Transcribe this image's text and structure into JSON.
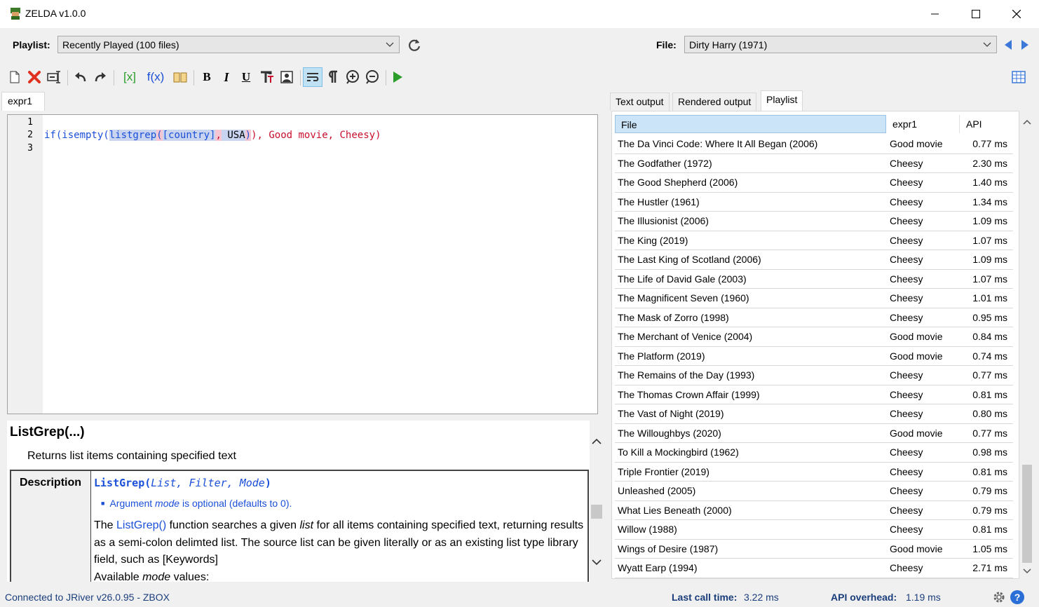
{
  "window": {
    "title": "ZELDA v1.0.0",
    "minimize": "—",
    "maximize": "☐",
    "close": "✕"
  },
  "playlist": {
    "label": "Playlist:",
    "value": "Recently Played (100 files)"
  },
  "file": {
    "label": "File:",
    "value": "Dirty Harry (1971)"
  },
  "toolbar": {
    "field_token": "[x]",
    "func_token": "f(x)",
    "bold": "B",
    "italic": "I",
    "underline": "U"
  },
  "editor": {
    "tab": "expr1",
    "line_numbers": [
      "1",
      "2",
      "3"
    ],
    "code": {
      "p1": "if(isempty(",
      "p2": "listg",
      "p3": "rep",
      "p4": "(",
      "p5": "[country]",
      "p6": ",",
      "p7": " USA",
      "p8": ")",
      "p9": "), Good movie, Cheesy)"
    }
  },
  "help": {
    "title": "ListGrep(...)",
    "subtitle": "Returns list items containing specified text",
    "desc_label": "Description",
    "sig_name": "ListGrep(",
    "sig_args": "List, Filter, Mode",
    "sig_close": ")",
    "arg_note_pre": "Argument ",
    "arg_note_em": "mode",
    "arg_note_post": " is optional (defaults to 0).",
    "body_1": "The ",
    "body_link": "ListGrep()",
    "body_2": " function searches a given ",
    "body_em": "list",
    "body_3": " for all items containing specified text, returning results as a semi-colon delimted list. The source list can be given literally or as an existing list type library field, such as [Keywords]",
    "body_4a": "Available ",
    "body_4em": "mode",
    "body_4b": " values:"
  },
  "right_tabs": [
    "Text output",
    "Rendered output",
    "Playlist"
  ],
  "table": {
    "columns": [
      "File",
      "expr1",
      "API"
    ],
    "rows": [
      [
        "The Da Vinci Code: Where It All Began (2006)",
        "Good movie",
        "0.77 ms"
      ],
      [
        "The Godfather (1972)",
        "Cheesy",
        "2.30 ms"
      ],
      [
        "The Good Shepherd (2006)",
        "Cheesy",
        "1.40 ms"
      ],
      [
        "The Hustler (1961)",
        "Cheesy",
        "1.34 ms"
      ],
      [
        "The Illusionist (2006)",
        "Cheesy",
        "1.09 ms"
      ],
      [
        "The King (2019)",
        "Cheesy",
        "1.07 ms"
      ],
      [
        "The Last King of Scotland (2006)",
        "Cheesy",
        "1.09 ms"
      ],
      [
        "The Life of David Gale (2003)",
        "Cheesy",
        "1.07 ms"
      ],
      [
        "The Magnificent Seven (1960)",
        "Cheesy",
        "1.01 ms"
      ],
      [
        "The Mask of Zorro (1998)",
        "Cheesy",
        "0.95 ms"
      ],
      [
        "The Merchant of Venice (2004)",
        "Good movie",
        "0.84 ms"
      ],
      [
        "The Platform (2019)",
        "Good movie",
        "0.74 ms"
      ],
      [
        "The Remains of the Day (1993)",
        "Cheesy",
        "0.77 ms"
      ],
      [
        "The Thomas Crown Affair (1999)",
        "Cheesy",
        "0.81 ms"
      ],
      [
        "The Vast of Night (2019)",
        "Cheesy",
        "0.80 ms"
      ],
      [
        "The Willoughbys (2020)",
        "Good movie",
        "0.77 ms"
      ],
      [
        "To Kill a Mockingbird (1962)",
        "Cheesy",
        "0.98 ms"
      ],
      [
        "Triple Frontier (2019)",
        "Cheesy",
        "0.81 ms"
      ],
      [
        "Unleashed (2005)",
        "Cheesy",
        "0.79 ms"
      ],
      [
        "What Lies Beneath (2000)",
        "Cheesy",
        "0.79 ms"
      ],
      [
        "Willow (1988)",
        "Cheesy",
        "0.81 ms"
      ],
      [
        "Wings of Desire (1987)",
        "Good movie",
        "1.05 ms"
      ],
      [
        "Wyatt Earp (1994)",
        "Cheesy",
        "2.71 ms"
      ]
    ]
  },
  "status": {
    "connection": "Connected to JRiver v26.0.95 - ZBOX",
    "last_call_label": "Last call time:",
    "last_call_value": "3.22 ms",
    "overhead_label": "API overhead:",
    "overhead_value": "1.19 ms"
  },
  "colors": {
    "accent": "#1a4fd8",
    "selected_header": "#cce4f7",
    "status_text": "#1a3d7c"
  }
}
